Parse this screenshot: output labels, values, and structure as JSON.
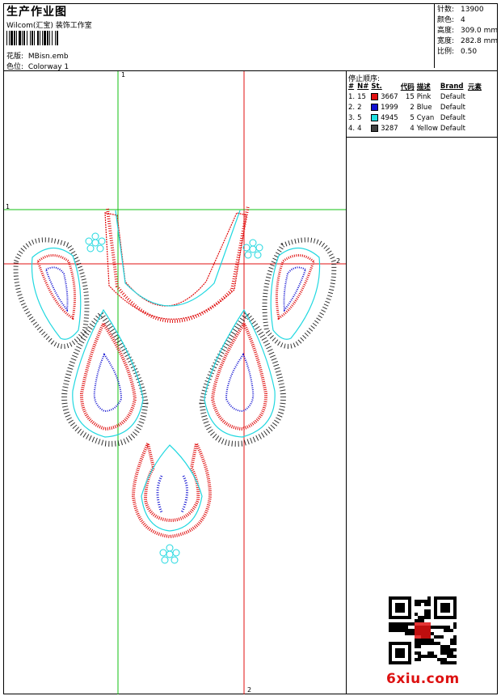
{
  "header": {
    "title": "生产作业图",
    "company": "Wilcom(汇宝) 装饰工作室",
    "design_label": "花版:",
    "design_value": "MBisn.emb",
    "colorway_label": "色位:",
    "colorway_value": "Colorway 1"
  },
  "stats": [
    {
      "label": "针数:",
      "value": "13900"
    },
    {
      "label": "颜色:",
      "value": "4"
    },
    {
      "label": "高度:",
      "value": "309.0 mm"
    },
    {
      "label": "宽度:",
      "value": "282.8 mm"
    },
    {
      "label": "比例:",
      "value": "0.50"
    }
  ],
  "stop_sequence": {
    "title": "停止顺序:",
    "headers": [
      "#",
      "N#",
      "St.",
      "代码",
      "描述",
      "Brand",
      "元素"
    ],
    "rows": [
      {
        "idx": "1.",
        "n": "15",
        "color": "#e01010",
        "st": "3667",
        "code": "15",
        "desc": "Pink",
        "brand": "Default"
      },
      {
        "idx": "2.",
        "n": "2",
        "color": "#1010d0",
        "st": "1999",
        "code": "2",
        "desc": "Blue",
        "brand": "Default"
      },
      {
        "idx": "3.",
        "n": "5",
        "color": "#20e0e0",
        "st": "4945",
        "code": "5",
        "desc": "Cyan",
        "brand": "Default"
      },
      {
        "idx": "4.",
        "n": "4",
        "color": "#404040",
        "st": "3287",
        "code": "4",
        "desc": "Yellow",
        "brand": "Default"
      }
    ]
  },
  "axes": {
    "label_1": "1",
    "label_2": "2"
  },
  "watermark": "6xiu.com",
  "colors": {
    "red": "#e01010",
    "blue": "#1010d0",
    "cyan": "#20d8e0",
    "green": "#10c010",
    "black": "#000000"
  }
}
